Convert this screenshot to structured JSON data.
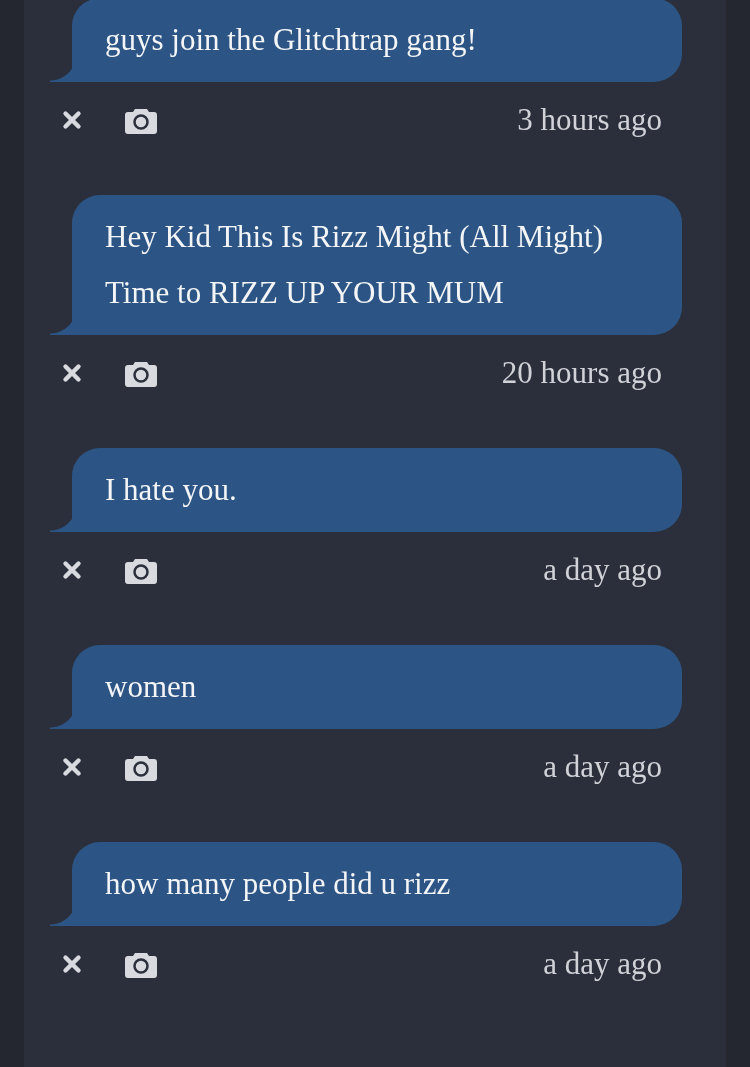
{
  "messages": [
    {
      "text": "guys join the Glitchtrap gang!",
      "time": "3 hours ago"
    },
    {
      "text": "Hey Kid This Is Rizz Might (All Might) Time to RIZZ UP YOUR MUM",
      "time": "20 hours ago"
    },
    {
      "text": "I hate you.",
      "time": "a day ago"
    },
    {
      "text": "women",
      "time": "a day ago"
    },
    {
      "text": "how many people did u rizz",
      "time": "a day ago"
    }
  ]
}
